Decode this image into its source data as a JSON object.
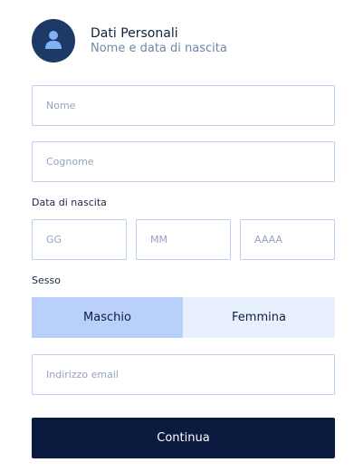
{
  "header": {
    "title": "Dati Personali",
    "subtitle": "Nome e data di nascita",
    "avatar_icon": "user-icon"
  },
  "form": {
    "first_name": {
      "placeholder": "Nome",
      "value": ""
    },
    "last_name": {
      "placeholder": "Cognome",
      "value": ""
    },
    "birth_date": {
      "label": "Data di nascita",
      "day": {
        "placeholder": "GG",
        "value": ""
      },
      "month": {
        "placeholder": "MM",
        "value": ""
      },
      "year": {
        "placeholder": "AAAA",
        "value": ""
      }
    },
    "sex": {
      "label": "Sesso",
      "options": [
        "Maschio",
        "Femmina"
      ],
      "selected": "Maschio"
    },
    "email": {
      "placeholder": "Indirizzo email",
      "value": ""
    },
    "submit_label": "Continua"
  },
  "colors": {
    "primary": "#0b1a3f",
    "avatar_bg": "#1d3a66",
    "segment_selected": "#b9d0fb",
    "segment_unselected": "#e9f0fd",
    "input_border": "#bcd0ef"
  }
}
